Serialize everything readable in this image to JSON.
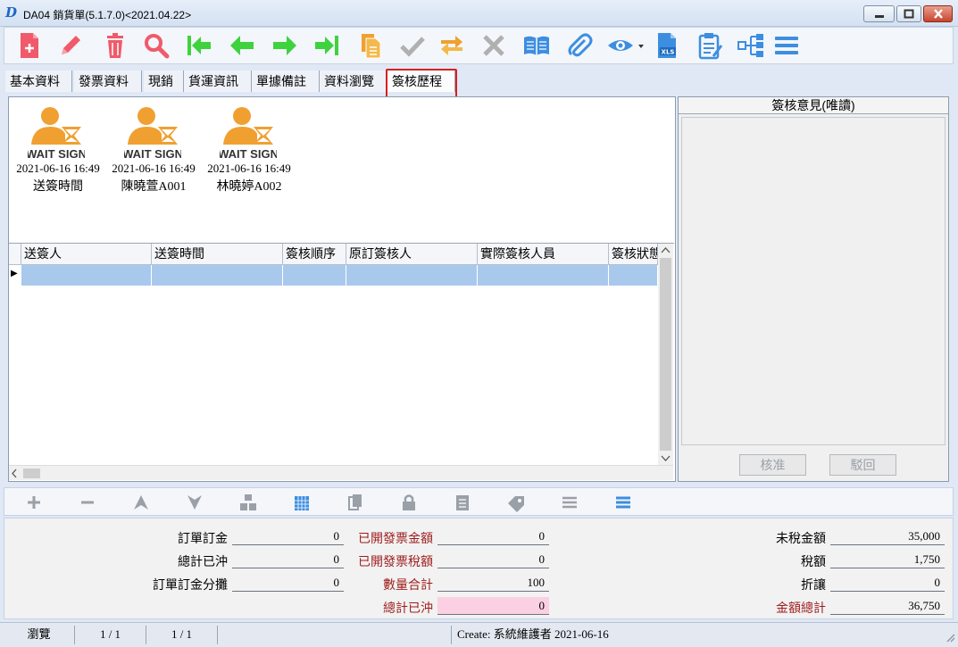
{
  "window": {
    "title": "DA04 銷貨單(5.1.7.0)<2021.04.22>",
    "logo_letter": "D"
  },
  "toolbar": {
    "icons": [
      "new-doc-icon",
      "edit-pencil-icon",
      "delete-trash-icon",
      "search-magnifier-icon",
      "first-record-icon",
      "prev-record-icon",
      "next-record-icon",
      "last-record-icon",
      "copy-doc-icon",
      "confirm-check-icon",
      "refresh-swap-icon",
      "cancel-x-icon",
      "book-icon",
      "attachment-clip-icon",
      "view-eye-icon",
      "export-xls-icon",
      "clipboard-icon",
      "tree-hierarchy-icon",
      "menu-lines-icon"
    ],
    "xls_label": "XLS"
  },
  "tabs": [
    "基本資料",
    "發票資料",
    "現銷",
    "貨運資訊",
    "單據備註",
    "資料瀏覽",
    "簽核歷程"
  ],
  "active_tab": "簽核歷程",
  "signers": [
    {
      "badge": "WAIT SIGN",
      "time": "2021-06-16 16:49",
      "name": "送簽時間"
    },
    {
      "badge": "WAIT SIGN",
      "time": "2021-06-16 16:49",
      "name": "陳曉萱A001"
    },
    {
      "badge": "WAIT SIGN",
      "time": "2021-06-16 16:49",
      "name": "林曉婷A002"
    }
  ],
  "grid": {
    "columns": [
      "送簽人",
      "送簽時間",
      "簽核順序",
      "原訂簽核人",
      "實際簽核人員",
      "簽核狀態"
    ],
    "row_marker": "▶"
  },
  "opinion": {
    "title": "簽核意見(唯讀)",
    "approve_label": "核准",
    "reject_label": "駁回"
  },
  "bottom_toolbar": {
    "icons": [
      "add-plus-icon",
      "remove-minus-icon",
      "move-up-icon",
      "move-down-icon",
      "structure-icon",
      "calendar-icon",
      "copy-icon",
      "lock-icon",
      "document-icon",
      "tag-icon",
      "list-icon",
      "menu-icon"
    ]
  },
  "summary": {
    "order_deposit_label": "訂單訂金",
    "order_deposit_value": "0",
    "total_offset_label": "總計已沖",
    "total_offset_value": "0",
    "deposit_split_label": "訂單訂金分攤",
    "deposit_split_value": "0",
    "invoiced_amount_label": "已開發票金額",
    "invoiced_amount_value": "0",
    "invoiced_tax_label": "已開發票稅額",
    "invoiced_tax_value": "0",
    "quantity_total_label": "數量合計",
    "quantity_total_value": "100",
    "total_offset2_label": "總計已沖",
    "total_offset2_value": "0",
    "untaxed_label": "未稅金額",
    "untaxed_value": "35,000",
    "tax_label": "稅額",
    "tax_value": "1,750",
    "discount_label": "折讓",
    "discount_value": "0",
    "grand_total_label": "金額總計",
    "grand_total_value": "36,750"
  },
  "status": {
    "mode": "瀏覽",
    "page1": "1 / 1",
    "page2": "1 / 1",
    "create_info": "Create: 系統維護者  2021-06-16"
  },
  "colors": {
    "green_nav": "#3fd23f",
    "red_icon": "#f05a6a",
    "blue_icon": "#3d8ee0",
    "orange_icon": "#f0a030",
    "highlight": "#d62020"
  }
}
